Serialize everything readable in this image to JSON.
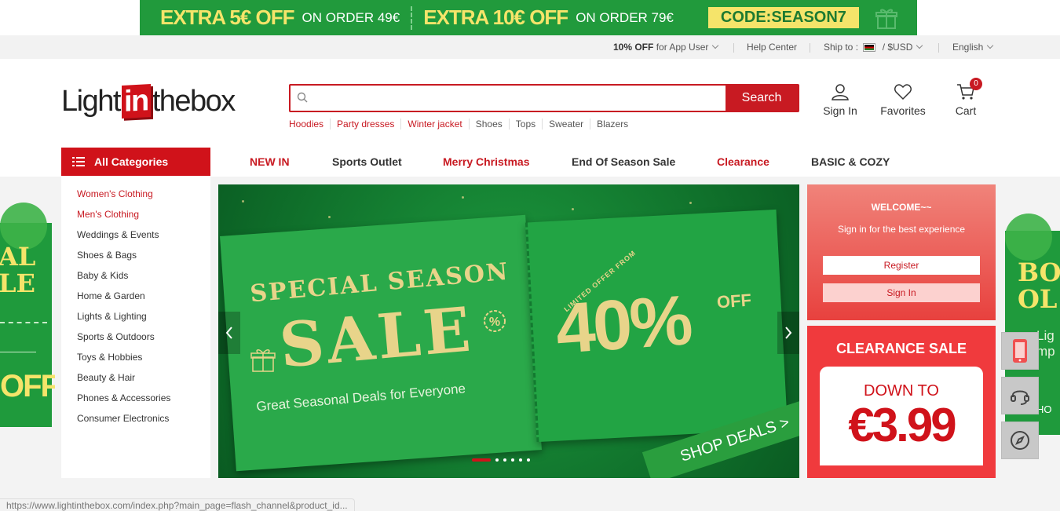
{
  "promo": {
    "offer1_big": "EXTRA 5€ OFF",
    "offer1_small": "ON ORDER 49€",
    "offer2_big": "EXTRA 10€ OFF",
    "offer2_small": "ON ORDER 79€",
    "code": "CODE:SEASON7",
    "colors": {
      "band": "#219a3c",
      "highlight": "#f5e46a"
    }
  },
  "utility": {
    "app_discount_bold": "10% OFF",
    "app_discount_rest": " for App User",
    "help": "Help Center",
    "ship_label": "Ship to :",
    "currency": "/ $USD",
    "language": "English"
  },
  "header": {
    "logo_left": "Light",
    "logo_in": "in",
    "logo_right": "thebox",
    "search_placeholder": "",
    "search_button": "Search",
    "hot_searches": [
      "Hoodies",
      "Party dresses",
      "Winter jacket",
      "Shoes",
      "Tops",
      "Sweater",
      "Blazers"
    ],
    "sign_in": "Sign In",
    "favorites": "Favorites",
    "cart": "Cart",
    "cart_count": "0",
    "accent": "#c81a22"
  },
  "nav": {
    "all_categories": "All Categories",
    "items": [
      "NEW IN",
      "Sports Outlet",
      "Merry Christmas",
      "End Of Season Sale",
      "Clearance",
      "BASIC & COZY"
    ]
  },
  "categories": [
    "Women's Clothing",
    "Men's Clothing",
    "Weddings & Events",
    "Shoes & Bags",
    "Baby & Kids",
    "Home & Garden",
    "Lights & Lighting",
    "Sports & Outdoors",
    "Toys & Hobbies",
    "Beauty & Hair",
    "Phones & Accessories",
    "Consumer Electronics"
  ],
  "hero": {
    "line1": "SPECIAL SEASON",
    "line2": "SALE",
    "line3": "Great Seasonal Deals for Everyone",
    "limited": "LIMITED OFFER FROM",
    "percent": "40%",
    "off": "OFF",
    "shop": "SHOP DEALS >",
    "slide_count": 6,
    "active_slide": 1
  },
  "welcome": {
    "title": "WELCOME~~",
    "subtitle": "Sign in for the best experience",
    "register": "Register",
    "sign_in": "Sign In"
  },
  "clearance": {
    "title": "CLEARANCE SALE",
    "down_to": "DOWN TO",
    "price": "€3.99"
  },
  "left_banner": {
    "big": "AL\nLE",
    "off": "OFF"
  },
  "right_banner": {
    "big": "BO\nOL Y",
    "small": "Lig\nmp",
    "bottom": "HO"
  },
  "status_bar": "https://www.lightinthebox.com/index.php?main_page=flash_channel&product_id..."
}
